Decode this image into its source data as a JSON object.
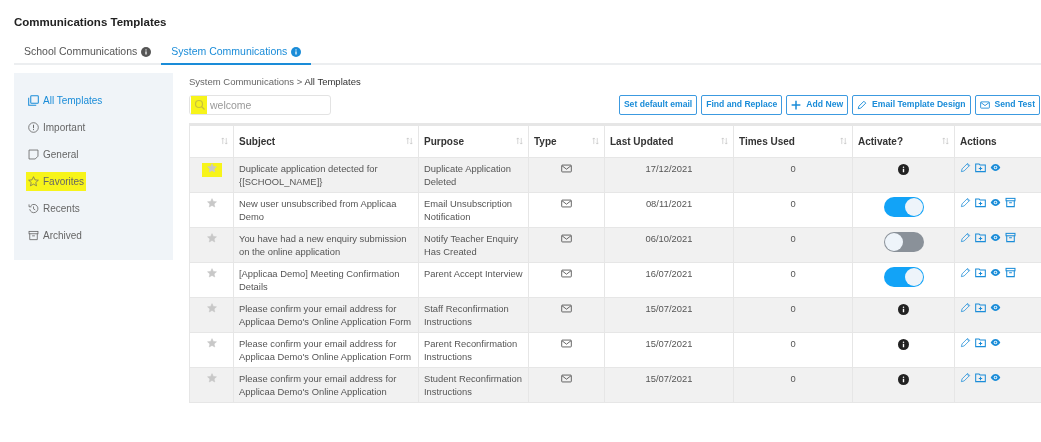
{
  "page_title": "Communications Templates",
  "tabs": [
    {
      "label": "School Communications",
      "selected": false
    },
    {
      "label": "System Communications",
      "selected": true
    }
  ],
  "sidebar": {
    "items": [
      {
        "label": "All Templates",
        "selected": true,
        "highlighted": false
      },
      {
        "label": "Important",
        "selected": false,
        "highlighted": false
      },
      {
        "label": "General",
        "selected": false,
        "highlighted": false
      },
      {
        "label": "Favorites",
        "selected": false,
        "highlighted": true
      },
      {
        "label": "Recents",
        "selected": false,
        "highlighted": false
      },
      {
        "label": "Archived",
        "selected": false,
        "highlighted": false
      }
    ]
  },
  "breadcrumb": {
    "parent": "System Communications >",
    "current": "All Templates"
  },
  "search": {
    "value": "welcome",
    "highlighted": true
  },
  "buttons": [
    {
      "label": "Set default email"
    },
    {
      "label": "Find and Replace"
    },
    {
      "label": "Add New"
    },
    {
      "label": "Email Template Design"
    },
    {
      "label": "Send Test"
    }
  ],
  "table": {
    "columns": [
      "",
      "Subject",
      "Purpose",
      "Type",
      "Last Updated",
      "Times Used",
      "Activate?",
      "Actions"
    ],
    "rows": [
      {
        "star_highlighted": true,
        "subject": "Duplicate application detected for {[SCHOOL_NAME]}",
        "purpose": "Duplicate Application Deleted",
        "last_updated": "17/12/2021",
        "times_used": "0",
        "activate": {
          "kind": "info"
        },
        "archivable": false
      },
      {
        "star_highlighted": false,
        "subject": "New user unsubscribed from Applicaa Demo",
        "purpose": "Email Unsubscription Notification",
        "last_updated": "08/11/2021",
        "times_used": "0",
        "activate": {
          "kind": "toggle",
          "on": true
        },
        "archivable": true
      },
      {
        "star_highlighted": false,
        "subject": "You have had a new enquiry submission on the online application",
        "purpose": "Notify Teacher Enquiry Has Created",
        "last_updated": "06/10/2021",
        "times_used": "0",
        "activate": {
          "kind": "toggle",
          "on": false
        },
        "archivable": true
      },
      {
        "star_highlighted": false,
        "subject": "[Applicaa Demo] Meeting Confirmation Details",
        "purpose": "Parent Accept Interview",
        "last_updated": "16/07/2021",
        "times_used": "0",
        "activate": {
          "kind": "toggle",
          "on": true
        },
        "archivable": true
      },
      {
        "star_highlighted": false,
        "subject": "Please confirm your email address for Applicaa Demo's Online Application Form",
        "purpose": "Staff Reconfirmation Instructions",
        "last_updated": "15/07/2021",
        "times_used": "0",
        "activate": {
          "kind": "info"
        },
        "archivable": false
      },
      {
        "star_highlighted": false,
        "subject": "Please confirm your email address for Applicaa Demo's Online Application Form",
        "purpose": "Parent Reconfirmation Instructions",
        "last_updated": "15/07/2021",
        "times_used": "0",
        "activate": {
          "kind": "info"
        },
        "archivable": false
      },
      {
        "star_highlighted": false,
        "subject": "Please confirm your email address for Applicaa Demo's Online Application",
        "purpose": "Student Reconfirmation Instructions",
        "last_updated": "15/07/2021",
        "times_used": "0",
        "activate": {
          "kind": "info"
        },
        "archivable": false
      }
    ]
  }
}
